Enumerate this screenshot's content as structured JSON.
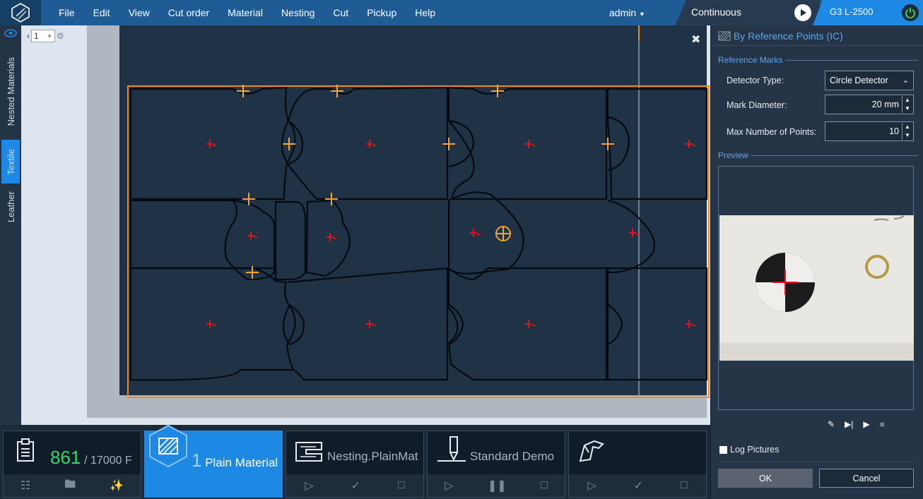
{
  "menu": {
    "items": [
      "File",
      "Edit",
      "View",
      "Cut order",
      "Material",
      "Nesting",
      "Cut",
      "Pickup",
      "Help"
    ],
    "user": "admin"
  },
  "status": {
    "mode": "Continuous",
    "machine": "G3 L-2500"
  },
  "sidetabs": {
    "nested": "Nested Materials",
    "textile": "Textile",
    "leather": "Leather"
  },
  "canvas": {
    "page_value": "1"
  },
  "panel": {
    "title": "By Reference Points (IC)",
    "section_marks": "Reference Marks",
    "detector_label": "Detector Type:",
    "detector_value": "Circle Detector",
    "diameter_label": "Mark Diameter:",
    "diameter_value": "20 mm",
    "maxpoints_label": "Max Number of Points:",
    "maxpoints_value": "10",
    "section_preview": "Preview",
    "log_pictures": "Log Pictures",
    "ok": "OK",
    "cancel": "Cancel"
  },
  "bottom": {
    "cutorder_count": "861",
    "cutorder_total": "/ 17000 F",
    "material_num": "1",
    "material_name": "Plain Material",
    "nesting_name": "Nesting.PlainMat",
    "cut_name": "Standard Demo"
  },
  "colors": {
    "accent": "#1e88e5",
    "marker": "#e8101a",
    "boundary": "#f08a1c"
  }
}
